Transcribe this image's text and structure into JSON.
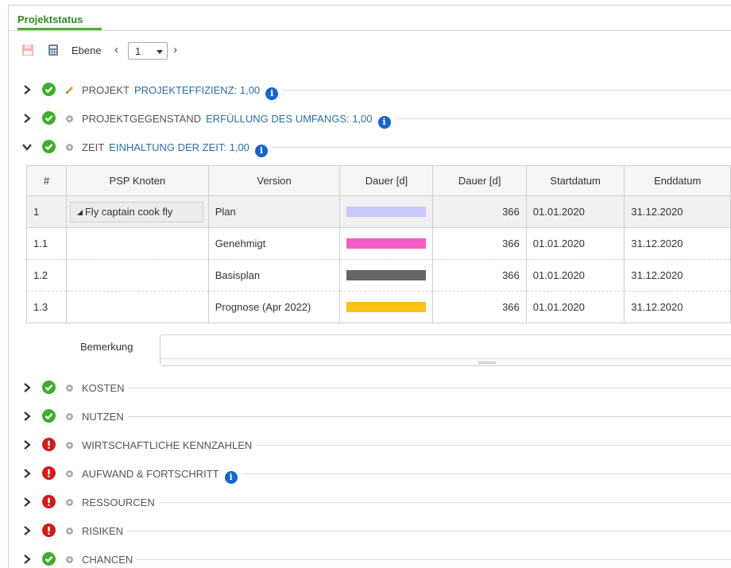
{
  "tab": {
    "label": "Projektstatus"
  },
  "toolbar": {
    "level_label": "Ebene",
    "level_value": "1",
    "prev": "‹",
    "next": "›"
  },
  "sections": [
    {
      "id": "projekt",
      "title": "PROJEKT",
      "metric": "PROJEKTEFFIZIENZ: 1,00",
      "status": "ok",
      "icon": "pencil-icon",
      "info": true
    },
    {
      "id": "gegenstand",
      "title": "PROJEKTGEGENSTAND",
      "metric": "ERFÜLLUNG DES UMFANGS: 1,00",
      "status": "ok",
      "icon": "gear-icon",
      "info": true
    },
    {
      "id": "zeit",
      "title": "ZEIT",
      "metric": "EINHALTUNG DER ZEIT: 1,00",
      "status": "ok",
      "icon": "gear-icon",
      "info": true,
      "expanded": true
    },
    {
      "id": "kosten",
      "title": "KOSTEN",
      "status": "ok",
      "icon": "gear-icon"
    },
    {
      "id": "nutzen",
      "title": "NUTZEN",
      "status": "ok",
      "icon": "gear-icon"
    },
    {
      "id": "wirtschaft",
      "title": "WIRTSCHAFTLICHE KENNZAHLEN",
      "status": "err",
      "icon": "gear-icon"
    },
    {
      "id": "aufwand",
      "title": "AUFWAND & FORTSCHRITT",
      "status": "err",
      "icon": "gear-icon",
      "info": true
    },
    {
      "id": "ressourcen",
      "title": "RESSOURCEN",
      "status": "err",
      "icon": "gear-icon"
    },
    {
      "id": "risiken",
      "title": "RISIKEN",
      "status": "err",
      "icon": "gear-icon"
    },
    {
      "id": "chancen",
      "title": "CHANCEN",
      "status": "ok",
      "icon": "gear-icon"
    }
  ],
  "table": {
    "headers": [
      "#",
      "PSP Knoten",
      "Version",
      "Dauer [d]",
      "Dauer [d]",
      "Startdatum",
      "Enddatum"
    ],
    "rows": [
      {
        "num": "1",
        "psp": "Fly captain cook fly",
        "version": "Plan",
        "color": "#c7c8fb",
        "duration": "366",
        "start": "01.01.2020",
        "end": "31.12.2020"
      },
      {
        "num": "1.1",
        "psp": "",
        "version": "Genehmigt",
        "color": "#f55cc7",
        "duration": "366",
        "start": "01.01.2020",
        "end": "31.12.2020"
      },
      {
        "num": "1.2",
        "psp": "",
        "version": "Basisplan",
        "color": "#666666",
        "duration": "366",
        "start": "01.01.2020",
        "end": "31.12.2020"
      },
      {
        "num": "1.3",
        "psp": "",
        "version": "Prognose (Apr 2022)",
        "color": "#fcc214",
        "duration": "366",
        "start": "01.01.2020",
        "end": "31.12.2020"
      }
    ]
  },
  "remark": {
    "label": "Bemerkung",
    "value": ""
  },
  "info_glyph": "i"
}
